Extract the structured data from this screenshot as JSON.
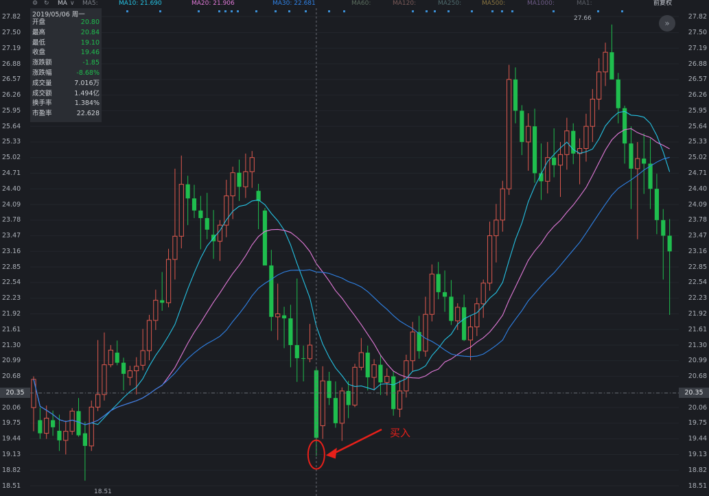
{
  "colors": {
    "up": "#e05a4f",
    "down": "#1fbe4e",
    "ma10": "#25c3e4",
    "ma20": "#e27ad9",
    "ma30": "#2f83e8",
    "background": "#1b1d22",
    "annotation": "#e8201a"
  },
  "indicator_bar": {
    "settings_icon": "gear-icon",
    "refresh_icon": "refresh-icon",
    "label": "MA",
    "dropdown_icon": "chevron-down-icon",
    "ma5": "MA5:",
    "ma10": "MA10: 21.690",
    "ma20": "MA20: 21.906",
    "ma30": "MA30: 22.681",
    "ma60": "MA60:",
    "ma120": "MA120:",
    "ma250": "MA250:",
    "ma500": "MA500:",
    "ma1000": "MA1000:",
    "ma1": "MA1:",
    "adjust": "前复权"
  },
  "price_axis": {
    "ticks": [
      "27.82",
      "27.50",
      "27.19",
      "26.88",
      "26.57",
      "26.26",
      "25.95",
      "25.64",
      "25.33",
      "25.02",
      "24.71",
      "24.40",
      "24.09",
      "23.78",
      "23.47",
      "23.16",
      "22.85",
      "22.54",
      "22.23",
      "21.92",
      "21.61",
      "21.30",
      "20.99",
      "20.68",
      "20.35",
      "20.06",
      "19.75",
      "19.44",
      "19.13",
      "18.82",
      "18.51"
    ],
    "crosshair_price": "20.35"
  },
  "info_panel": {
    "date": "2019/05/06 周一",
    "rows": [
      {
        "label": "开盘",
        "value": "20.80",
        "tone": "down"
      },
      {
        "label": "最高",
        "value": "20.84",
        "tone": "down"
      },
      {
        "label": "最低",
        "value": "19.10",
        "tone": "down"
      },
      {
        "label": "收盘",
        "value": "19.46",
        "tone": "down"
      },
      {
        "label": "涨跌额",
        "value": "-1.85",
        "tone": "down"
      },
      {
        "label": "涨跌幅",
        "value": "-8.68%",
        "tone": "down"
      },
      {
        "label": "成交量",
        "value": "7.016万",
        "tone": "neu"
      },
      {
        "label": "成交额",
        "value": "1.494亿",
        "tone": "neu"
      },
      {
        "label": "换手率",
        "value": "1.384%",
        "tone": "neu"
      },
      {
        "label": "市盈率",
        "value": "22.628",
        "tone": "neu"
      }
    ]
  },
  "markers": {
    "high_label": "27.66",
    "low_label": "18.51",
    "buy_label": "买入",
    "forward_icon": "double-chevron-right-icon"
  },
  "chart_data": {
    "type": "candlestick",
    "ylim": [
      18.51,
      27.82
    ],
    "crosshair_index": 44,
    "buy_index": 44,
    "ohlc": [
      [
        20.06,
        20.68,
        19.59,
        20.62
      ],
      [
        19.81,
        20.06,
        19.44,
        19.55
      ],
      [
        19.55,
        20.1,
        19.44,
        19.85
      ],
      [
        19.81,
        20.0,
        19.5,
        19.67
      ],
      [
        19.6,
        19.92,
        19.2,
        19.41
      ],
      [
        19.41,
        19.8,
        19.13,
        19.59
      ],
      [
        19.59,
        20.05,
        19.52,
        19.99
      ],
      [
        19.99,
        20.25,
        19.48,
        19.51
      ],
      [
        19.55,
        19.78,
        18.61,
        19.3
      ],
      [
        19.3,
        20.2,
        19.2,
        20.07
      ],
      [
        20.07,
        21.4,
        19.99,
        20.32
      ],
      [
        20.32,
        21.55,
        20.2,
        20.91
      ],
      [
        20.91,
        21.3,
        20.86,
        21.2
      ],
      [
        21.15,
        21.39,
        20.9,
        20.95
      ],
      [
        20.95,
        21.05,
        20.4,
        20.73
      ],
      [
        20.66,
        20.89,
        20.5,
        20.79
      ],
      [
        20.79,
        21.06,
        20.32,
        20.88
      ],
      [
        20.9,
        21.62,
        20.8,
        21.19
      ],
      [
        21.19,
        21.9,
        21.0,
        21.79
      ],
      [
        21.79,
        22.4,
        21.6,
        22.19
      ],
      [
        22.19,
        22.75,
        21.98,
        22.14
      ],
      [
        22.14,
        23.21,
        22.05,
        23.0
      ],
      [
        23.0,
        24.8,
        22.6,
        23.46
      ],
      [
        23.46,
        25.06,
        23.22,
        24.49
      ],
      [
        24.49,
        24.66,
        23.68,
        24.21
      ],
      [
        24.21,
        24.48,
        23.82,
        23.97
      ],
      [
        23.97,
        24.26,
        23.2,
        23.82
      ],
      [
        23.82,
        24.32,
        23.4,
        23.59
      ],
      [
        23.49,
        23.98,
        23.01,
        23.36
      ],
      [
        23.36,
        23.78,
        22.97,
        23.68
      ],
      [
        23.68,
        24.58,
        23.44,
        24.26
      ],
      [
        24.26,
        24.84,
        23.8,
        24.72
      ],
      [
        24.72,
        24.98,
        24.16,
        24.44
      ],
      [
        24.44,
        25.1,
        24.22,
        24.74
      ],
      [
        24.74,
        25.15,
        24.42,
        25.02
      ],
      [
        24.36,
        24.5,
        23.6,
        24.16
      ],
      [
        23.97,
        24.02,
        22.94,
        22.88
      ],
      [
        22.88,
        23.19,
        21.58,
        21.86
      ],
      [
        21.86,
        22.52,
        21.4,
        21.92
      ],
      [
        21.89,
        22.06,
        21.24,
        21.83
      ],
      [
        21.83,
        22.1,
        20.86,
        21.3
      ],
      [
        21.3,
        22.62,
        20.57,
        21.04
      ],
      [
        21.04,
        21.29,
        20.58,
        21.03
      ],
      [
        21.03,
        21.72,
        20.96,
        21.3
      ],
      [
        20.8,
        20.84,
        19.1,
        19.46
      ],
      [
        19.7,
        20.88,
        19.44,
        20.59
      ],
      [
        20.59,
        20.77,
        20.11,
        20.25
      ],
      [
        20.25,
        20.58,
        19.66,
        19.75
      ],
      [
        19.75,
        20.46,
        19.4,
        20.39
      ],
      [
        20.39,
        20.59,
        19.85,
        20.11
      ],
      [
        20.11,
        20.93,
        20.07,
        20.86
      ],
      [
        20.86,
        21.44,
        20.8,
        21.15
      ],
      [
        21.15,
        21.29,
        20.4,
        20.66
      ],
      [
        20.66,
        21.02,
        20.4,
        20.91
      ],
      [
        20.91,
        21.11,
        20.31,
        20.56
      ],
      [
        20.56,
        20.84,
        20.3,
        20.68
      ],
      [
        20.68,
        20.78,
        19.9,
        20.03
      ],
      [
        20.03,
        20.6,
        19.87,
        20.39
      ],
      [
        20.39,
        21.11,
        20.26,
        20.99
      ],
      [
        20.99,
        21.76,
        20.77,
        21.56
      ],
      [
        21.56,
        21.88,
        21.03,
        21.18
      ],
      [
        21.18,
        22.26,
        21.07,
        21.91
      ],
      [
        21.91,
        22.9,
        21.77,
        22.71
      ],
      [
        22.71,
        22.95,
        22.21,
        22.35
      ],
      [
        22.35,
        22.78,
        21.96,
        22.26
      ],
      [
        22.26,
        22.59,
        21.7,
        21.78
      ],
      [
        21.78,
        22.13,
        21.6,
        22.05
      ],
      [
        22.05,
        22.3,
        21.38,
        21.4
      ],
      [
        21.4,
        21.87,
        21.0,
        21.66
      ],
      [
        21.66,
        22.24,
        21.48,
        22.12
      ],
      [
        22.12,
        22.6,
        21.84,
        22.53
      ],
      [
        22.53,
        23.75,
        22.38,
        23.47
      ],
      [
        23.47,
        24.1,
        22.94,
        23.78
      ],
      [
        23.78,
        24.56,
        23.55,
        24.4
      ],
      [
        24.4,
        26.86,
        24.28,
        26.57
      ],
      [
        26.57,
        26.81,
        25.7,
        25.95
      ],
      [
        25.95,
        26.06,
        25.07,
        25.33
      ],
      [
        25.33,
        25.9,
        24.76,
        25.64
      ],
      [
        25.64,
        25.99,
        24.52,
        24.71
      ],
      [
        24.71,
        25.3,
        24.18,
        24.55
      ],
      [
        24.55,
        25.33,
        24.31,
        25.02
      ],
      [
        25.02,
        25.6,
        24.63,
        24.87
      ],
      [
        24.87,
        25.33,
        24.24,
        25.08
      ],
      [
        25.08,
        25.81,
        24.78,
        25.55
      ],
      [
        25.55,
        25.7,
        24.89,
        25.1
      ],
      [
        25.1,
        25.4,
        24.49,
        25.2
      ],
      [
        25.2,
        25.89,
        24.94,
        25.64
      ],
      [
        25.64,
        26.38,
        25.33,
        26.18
      ],
      [
        26.18,
        26.99,
        25.97,
        26.72
      ],
      [
        26.72,
        27.3,
        26.44,
        27.11
      ],
      [
        27.11,
        27.66,
        26.6,
        26.57
      ],
      [
        26.57,
        26.7,
        25.7,
        26.0
      ],
      [
        26.0,
        26.05,
        24.9,
        25.3
      ],
      [
        25.3,
        25.64,
        24.0,
        24.8
      ],
      [
        24.8,
        25.33,
        23.4,
        25.0
      ],
      [
        25.0,
        25.5,
        24.3,
        24.9
      ],
      [
        24.9,
        25.4,
        24.0,
        24.4
      ],
      [
        24.4,
        24.7,
        23.5,
        23.78
      ],
      [
        23.78,
        24.0,
        22.6,
        23.47
      ],
      [
        23.47,
        23.8,
        21.9,
        23.16
      ]
    ]
  }
}
